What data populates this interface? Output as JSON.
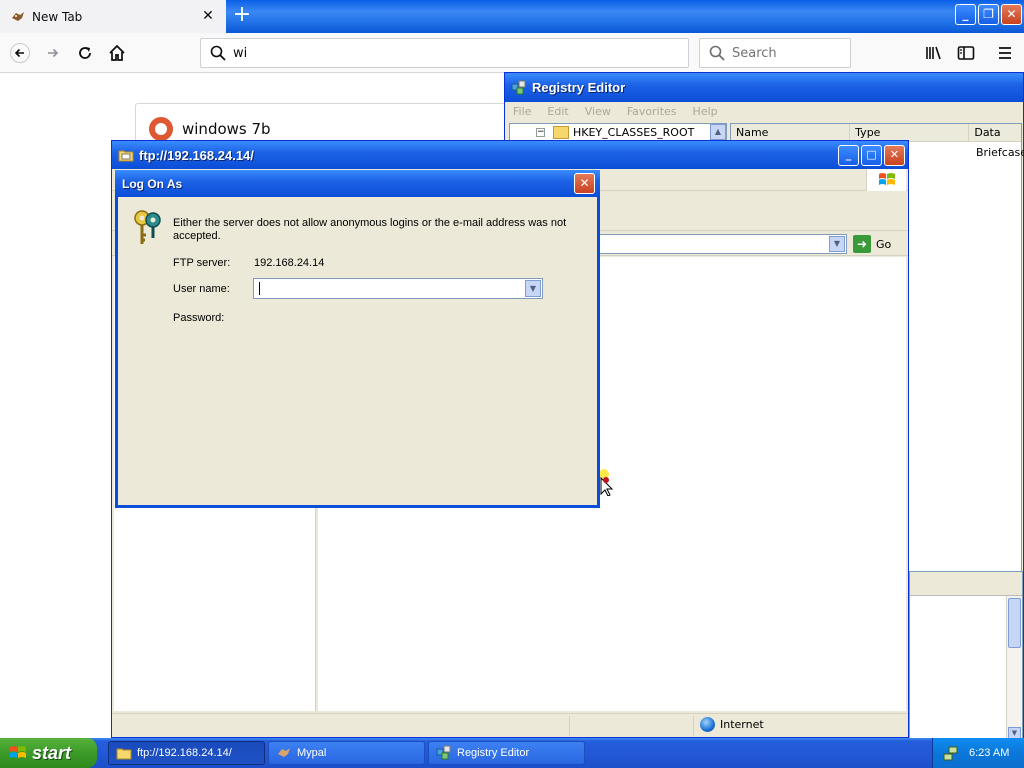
{
  "browser": {
    "tab": {
      "title": "New Tab"
    },
    "urlbar": {
      "value": "wi"
    },
    "searchbar": {
      "placeholder": "Search"
    },
    "suggestion": {
      "text": "windows 7b"
    }
  },
  "regedit": {
    "title": "Registry Editor",
    "menu": [
      "File",
      "Edit",
      "View",
      "Favorites",
      "Help"
    ],
    "tree": {
      "root": "HKEY_CLASSES_ROOT"
    },
    "columns": [
      "Name",
      "Type",
      "Data"
    ],
    "row_data": "Briefcase"
  },
  "ftp": {
    "title": "ftp://192.168.24.14/",
    "go_label": "Go",
    "status_zone": "Internet"
  },
  "logon": {
    "title": "Log On As",
    "message": "Either the server does not allow anonymous logins or the e-mail address was not accepted.",
    "ftp_server_label": "FTP server:",
    "ftp_server_value": "192.168.24.14",
    "username_label": "User name:",
    "username_value": "",
    "password_label": "Password:"
  },
  "taskbar": {
    "start_label": "start",
    "tasks": [
      {
        "label": "ftp://192.168.24.14/"
      },
      {
        "label": "Mypal"
      },
      {
        "label": "Registry Editor"
      }
    ],
    "clock": "6:23 AM"
  },
  "colors": {
    "xp_blue": "#0a4ed8",
    "start_green": "#3c9b28",
    "close_red": "#c8421f"
  }
}
